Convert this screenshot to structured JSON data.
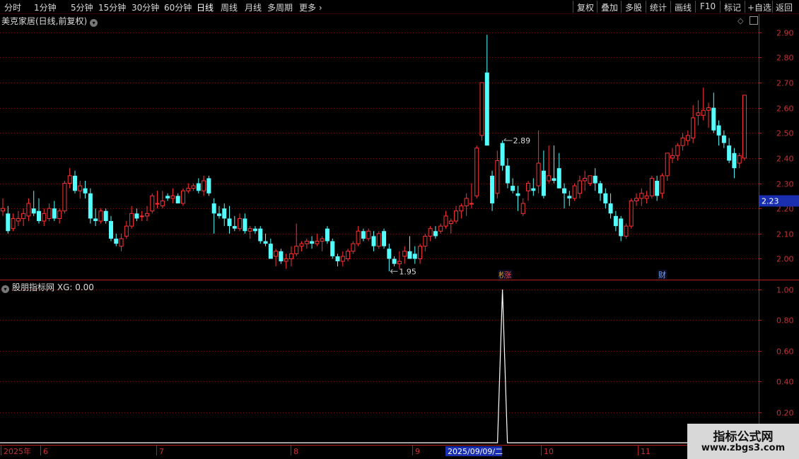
{
  "toolbar": {
    "left_items": [
      "分时",
      "1分钟",
      "5分钟",
      "15分钟",
      "30分钟",
      "60分钟",
      "日线",
      "周线",
      "月线",
      "多周期",
      "更多"
    ],
    "active": "日线",
    "right_items": [
      "复权",
      "叠加",
      "多股",
      "统计",
      "画线",
      "F10",
      "标记",
      "+自选",
      "返回"
    ]
  },
  "main_chart": {
    "title": "美克家居(日线,前复权)",
    "y_ticks": [
      "2.90",
      "2.80",
      "2.70",
      "2.60",
      "2.50",
      "2.40",
      "2.30",
      "2.20",
      "2.10",
      "2.00"
    ],
    "y_min": 1.92,
    "y_max": 2.93,
    "current_price": "2.23",
    "high_label": "2.89",
    "low_label": "1.95",
    "markers": [
      {
        "text": "榜",
        "color": "#e8a000",
        "idx": 97
      },
      {
        "text": "涨",
        "color": "#ff4040",
        "idx": 98
      },
      {
        "text": "财",
        "color": "#6aa0ff",
        "idx": 128
      }
    ]
  },
  "indicator": {
    "title": "股朋指标网",
    "value_label": "XG: 0.00",
    "y_ticks": [
      "1.00",
      "0.80",
      "0.60",
      "0.40",
      "0.20"
    ],
    "peak_index": 97
  },
  "date_axis": {
    "labels": [
      "2025年",
      "6",
      "7",
      "8",
      "9",
      "2025/09/09/二",
      "10",
      "11"
    ],
    "highlight": "2025/09/09/二"
  },
  "watermark": {
    "line1": "指标公式网",
    "line2": "www.zbgs3.com"
  },
  "chart_data": {
    "type": "candlestick",
    "ohlc": [
      [
        2.19,
        2.24,
        2.17,
        2.2
      ],
      [
        2.18,
        2.21,
        2.1,
        2.11
      ],
      [
        2.12,
        2.18,
        2.11,
        2.16
      ],
      [
        2.15,
        2.19,
        2.13,
        2.16
      ],
      [
        2.16,
        2.2,
        2.13,
        2.18
      ],
      [
        2.17,
        2.24,
        2.15,
        2.22
      ],
      [
        2.2,
        2.27,
        2.17,
        2.18
      ],
      [
        2.19,
        2.24,
        2.14,
        2.15
      ],
      [
        2.15,
        2.2,
        2.13,
        2.18
      ],
      [
        2.16,
        2.22,
        2.15,
        2.2
      ],
      [
        2.2,
        2.23,
        2.15,
        2.16
      ],
      [
        2.16,
        2.2,
        2.14,
        2.19
      ],
      [
        2.19,
        2.31,
        2.18,
        2.3
      ],
      [
        2.3,
        2.36,
        2.28,
        2.33
      ],
      [
        2.33,
        2.35,
        2.26,
        2.27
      ],
      [
        2.27,
        2.31,
        2.24,
        2.29
      ],
      [
        2.28,
        2.31,
        2.24,
        2.26
      ],
      [
        2.26,
        2.28,
        2.14,
        2.16
      ],
      [
        2.16,
        2.2,
        2.13,
        2.15
      ],
      [
        2.15,
        2.2,
        2.14,
        2.19
      ],
      [
        2.19,
        2.2,
        2.14,
        2.15
      ],
      [
        2.15,
        2.17,
        2.07,
        2.08
      ],
      [
        2.08,
        2.1,
        2.05,
        2.06
      ],
      [
        2.05,
        2.1,
        2.03,
        2.08
      ],
      [
        2.09,
        2.15,
        2.08,
        2.13
      ],
      [
        2.13,
        2.21,
        2.12,
        2.18
      ],
      [
        2.18,
        2.2,
        2.15,
        2.16
      ],
      [
        2.17,
        2.19,
        2.15,
        2.17
      ],
      [
        2.17,
        2.21,
        2.15,
        2.18
      ],
      [
        2.19,
        2.26,
        2.18,
        2.25
      ],
      [
        2.22,
        2.27,
        2.2,
        2.22
      ],
      [
        2.21,
        2.27,
        2.2,
        2.23
      ],
      [
        2.25,
        2.26,
        2.23,
        2.24
      ],
      [
        2.24,
        2.28,
        2.22,
        2.25
      ],
      [
        2.25,
        2.26,
        2.22,
        2.22
      ],
      [
        2.22,
        2.28,
        2.21,
        2.27
      ],
      [
        2.27,
        2.3,
        2.26,
        2.28
      ],
      [
        2.28,
        2.3,
        2.27,
        2.29
      ],
      [
        2.3,
        2.32,
        2.26,
        2.27
      ],
      [
        2.27,
        2.33,
        2.25,
        2.31
      ],
      [
        2.32,
        2.33,
        2.25,
        2.26
      ],
      [
        2.22,
        2.24,
        2.1,
        2.18
      ],
      [
        2.18,
        2.21,
        2.16,
        2.17
      ],
      [
        2.2,
        2.22,
        2.13,
        2.16
      ],
      [
        2.16,
        2.21,
        2.1,
        2.13
      ],
      [
        2.13,
        2.17,
        2.11,
        2.12
      ],
      [
        2.12,
        2.18,
        2.11,
        2.16
      ],
      [
        2.16,
        2.18,
        2.1,
        2.11
      ],
      [
        2.11,
        2.13,
        2.08,
        2.12
      ],
      [
        2.12,
        2.13,
        2.1,
        2.11
      ],
      [
        2.12,
        2.13,
        2.06,
        2.07
      ],
      [
        2.07,
        2.1,
        2.05,
        2.06
      ],
      [
        2.06,
        2.08,
        2.0,
        2.0
      ],
      [
        2.01,
        2.04,
        1.97,
        2.03
      ],
      [
        2.03,
        2.04,
        1.98,
        1.99
      ],
      [
        1.99,
        2.02,
        1.96,
        2.0
      ],
      [
        2.0,
        2.05,
        1.97,
        2.02
      ],
      [
        2.02,
        2.14,
        2.01,
        2.05
      ],
      [
        2.05,
        2.07,
        2.03,
        2.06
      ],
      [
        2.06,
        2.08,
        2.04,
        2.07
      ],
      [
        2.07,
        2.09,
        2.04,
        2.06
      ],
      [
        2.06,
        2.1,
        2.05,
        2.07
      ],
      [
        2.07,
        2.09,
        2.03,
        2.08
      ],
      [
        2.12,
        2.13,
        2.06,
        2.07
      ],
      [
        2.07,
        2.08,
        2.0,
        2.01
      ],
      [
        2.01,
        2.02,
        1.97,
        1.99
      ],
      [
        1.99,
        2.03,
        1.97,
        2.01
      ],
      [
        2.0,
        2.04,
        1.99,
        2.03
      ],
      [
        2.03,
        2.07,
        2.02,
        2.06
      ],
      [
        2.06,
        2.13,
        2.05,
        2.11
      ],
      [
        2.11,
        2.12,
        2.07,
        2.08
      ],
      [
        2.08,
        2.12,
        2.07,
        2.11
      ],
      [
        2.09,
        2.11,
        2.03,
        2.05
      ],
      [
        2.05,
        2.11,
        2.04,
        2.1
      ],
      [
        2.11,
        2.12,
        2.04,
        2.05
      ],
      [
        2.04,
        2.06,
        1.95,
        2.0
      ],
      [
        2.0,
        2.01,
        1.97,
        1.98
      ],
      [
        1.98,
        2.03,
        1.96,
        1.99
      ],
      [
        2.01,
        2.05,
        1.98,
        2.03
      ],
      [
        2.03,
        2.09,
        2.02,
        2.0
      ],
      [
        2.02,
        2.05,
        1.98,
        2.0
      ],
      [
        2.0,
        2.06,
        1.98,
        2.05
      ],
      [
        2.05,
        2.1,
        2.03,
        2.09
      ],
      [
        2.09,
        2.13,
        2.07,
        2.12
      ],
      [
        2.11,
        2.13,
        2.08,
        2.09
      ],
      [
        2.11,
        2.14,
        2.1,
        2.13
      ],
      [
        2.13,
        2.19,
        2.12,
        2.17
      ],
      [
        2.14,
        2.16,
        2.1,
        2.15
      ],
      [
        2.15,
        2.21,
        2.14,
        2.19
      ],
      [
        2.19,
        2.22,
        2.16,
        2.21
      ],
      [
        2.21,
        2.26,
        2.17,
        2.24
      ],
      [
        2.22,
        2.3,
        2.2,
        2.22
      ],
      [
        2.25,
        2.45,
        2.24,
        2.44
      ],
      [
        2.49,
        2.69,
        2.47,
        2.7
      ],
      [
        2.74,
        2.89,
        2.45,
        2.45
      ],
      [
        2.33,
        2.35,
        2.19,
        2.22
      ],
      [
        2.26,
        2.43,
        2.24,
        2.39
      ],
      [
        2.46,
        2.47,
        2.35,
        2.37
      ],
      [
        2.37,
        2.4,
        2.28,
        2.3
      ],
      [
        2.29,
        2.32,
        2.26,
        2.27
      ],
      [
        2.26,
        2.29,
        2.19,
        2.25
      ],
      [
        2.18,
        2.24,
        2.17,
        2.22
      ],
      [
        2.27,
        2.31,
        2.23,
        2.3
      ],
      [
        2.28,
        2.32,
        2.25,
        2.27
      ],
      [
        2.29,
        2.51,
        2.26,
        2.38
      ],
      [
        2.35,
        2.43,
        2.24,
        2.25
      ],
      [
        2.31,
        2.45,
        2.3,
        2.33
      ],
      [
        2.32,
        2.45,
        2.3,
        2.31
      ],
      [
        2.36,
        2.42,
        2.28,
        2.28
      ],
      [
        2.28,
        2.3,
        2.2,
        2.26
      ],
      [
        2.25,
        2.27,
        2.21,
        2.24
      ],
      [
        2.24,
        2.3,
        2.23,
        2.29
      ],
      [
        2.26,
        2.33,
        2.24,
        2.31
      ],
      [
        2.31,
        2.35,
        2.27,
        2.32
      ],
      [
        2.3,
        2.33,
        2.29,
        2.33
      ],
      [
        2.33,
        2.36,
        2.27,
        2.3
      ],
      [
        2.3,
        2.31,
        2.23,
        2.26
      ],
      [
        2.26,
        2.28,
        2.2,
        2.22
      ],
      [
        2.22,
        2.26,
        2.16,
        2.18
      ],
      [
        2.17,
        2.19,
        2.11,
        2.13
      ],
      [
        2.16,
        2.17,
        2.07,
        2.09
      ],
      [
        2.09,
        2.14,
        2.08,
        2.13
      ],
      [
        2.13,
        2.24,
        2.12,
        2.23
      ],
      [
        2.23,
        2.26,
        2.21,
        2.24
      ],
      [
        2.24,
        2.28,
        2.21,
        2.26
      ],
      [
        2.24,
        2.27,
        2.22,
        2.25
      ],
      [
        2.25,
        2.33,
        2.24,
        2.32
      ],
      [
        2.31,
        2.33,
        2.23,
        2.25
      ],
      [
        2.26,
        2.34,
        2.24,
        2.33
      ],
      [
        2.33,
        2.42,
        2.31,
        2.42
      ],
      [
        2.4,
        2.44,
        2.38,
        2.41
      ],
      [
        2.41,
        2.46,
        2.39,
        2.45
      ],
      [
        2.45,
        2.5,
        2.43,
        2.48
      ],
      [
        2.47,
        2.51,
        2.45,
        2.49
      ],
      [
        2.48,
        2.61,
        2.46,
        2.56
      ],
      [
        2.57,
        2.63,
        2.53,
        2.58
      ],
      [
        2.57,
        2.68,
        2.55,
        2.59
      ],
      [
        2.59,
        2.62,
        2.52,
        2.6
      ],
      [
        2.6,
        2.66,
        2.5,
        2.51
      ],
      [
        2.53,
        2.55,
        2.45,
        2.49
      ],
      [
        2.49,
        2.51,
        2.44,
        2.46
      ],
      [
        2.45,
        2.48,
        2.38,
        2.39
      ],
      [
        2.42,
        2.44,
        2.32,
        2.36
      ],
      [
        2.38,
        2.42,
        2.36,
        2.41
      ],
      [
        2.4,
        2.65,
        2.39,
        2.65
      ]
    ],
    "indicator_values_note": "0 everywhere except 1.00 at index 97"
  }
}
